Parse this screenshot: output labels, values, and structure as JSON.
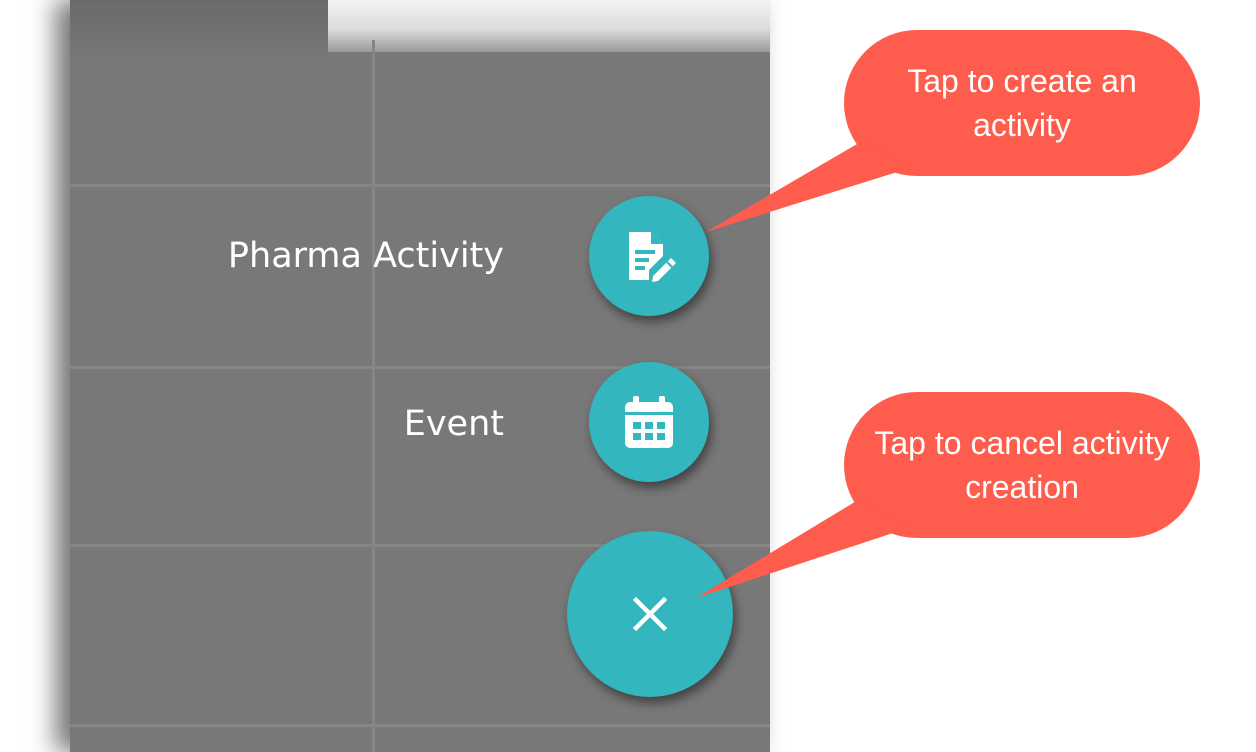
{
  "speed_dial": {
    "actions": [
      {
        "label": "Pharma Activity",
        "icon": "document-edit-icon"
      },
      {
        "label": "Event",
        "icon": "calendar-icon"
      }
    ],
    "main": {
      "icon": "close-icon"
    }
  },
  "callouts": {
    "create": "Tap to create an activity",
    "cancel": "Tap to cancel activity creation"
  },
  "colors": {
    "fab": "#33b6bd",
    "callout": "#fe5c4c",
    "overlay": "#787878"
  }
}
